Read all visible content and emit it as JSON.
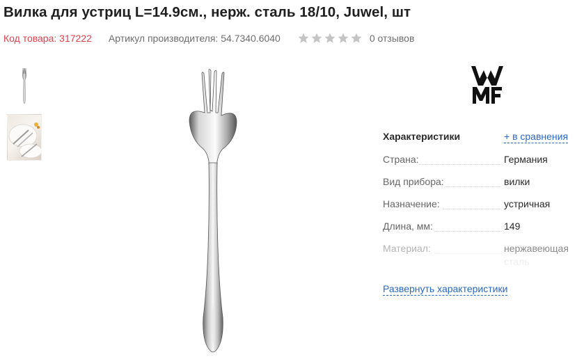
{
  "product": {
    "title": "Вилка для устриц L=14.9см., нерж. сталь 18/10, Juwel, шт",
    "code": "Код товара: 317222",
    "article": "Артикул производителя: 54.7340.6040",
    "rating": 0,
    "rating_max": 5,
    "reviews": "0 отзывов"
  },
  "colors": {
    "accent_red": "#e0414a",
    "link_blue": "#2a68c7",
    "star_gray": "#c4c4c4"
  },
  "brand": {
    "logo_icon": "wmf-logo-icon"
  },
  "specs": {
    "title": "Характеристики",
    "compare": "+ в сравнения",
    "rows": [
      {
        "label": "Страна:",
        "value": "Германия"
      },
      {
        "label": "Вид прибора:",
        "value": "вилки"
      },
      {
        "label": "Назначение:",
        "value": "устричная"
      },
      {
        "label": "Длина, мм:",
        "value": "149"
      },
      {
        "label": "Материал:",
        "value": "нержавеющая",
        "value2": "сталь"
      }
    ],
    "expand": "Развернуть характеристики"
  }
}
